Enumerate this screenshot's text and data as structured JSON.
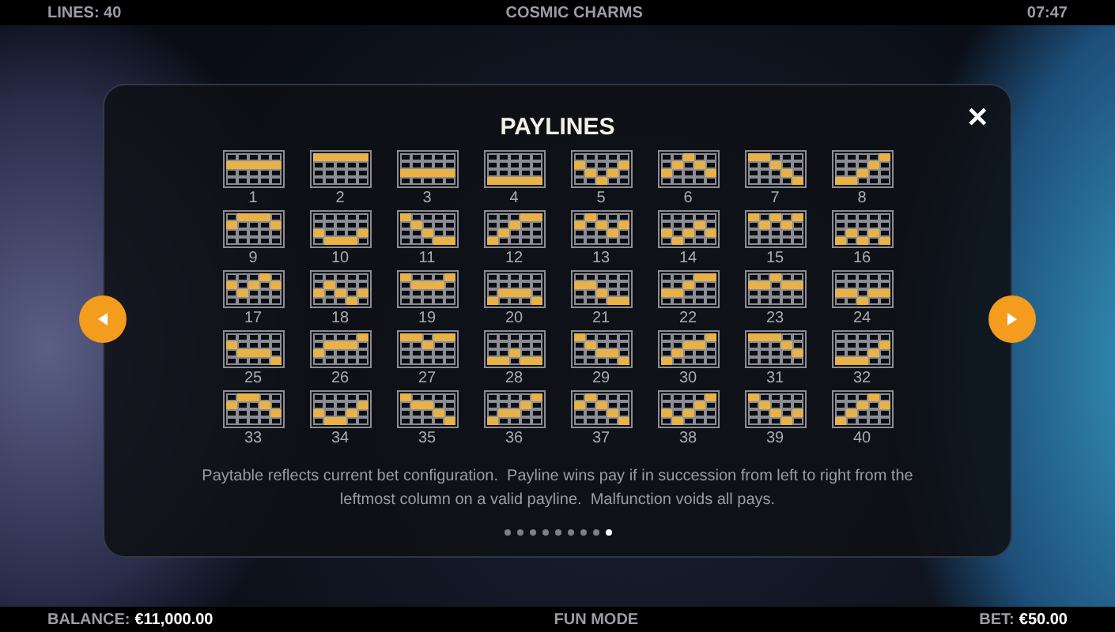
{
  "top_bar": {
    "lines": "LINES: 40",
    "title": "COSMIC CHARMS",
    "time": "07:47"
  },
  "dialog": {
    "title": "PAYLINES",
    "close": "✕",
    "paylines": [
      {
        "number": "1",
        "lit": [
          [
            false,
            false,
            false,
            false,
            false
          ],
          [
            true,
            true,
            true,
            true,
            true
          ],
          [
            false,
            false,
            false,
            false,
            false
          ],
          [
            false,
            false,
            false,
            false,
            false
          ]
        ]
      },
      {
        "number": "2",
        "lit": [
          [
            true,
            true,
            true,
            true,
            true
          ],
          [
            false,
            false,
            false,
            false,
            false
          ],
          [
            false,
            false,
            false,
            false,
            false
          ],
          [
            false,
            false,
            false,
            false,
            false
          ]
        ]
      },
      {
        "number": "3",
        "lit": [
          [
            false,
            false,
            false,
            false,
            false
          ],
          [
            false,
            false,
            false,
            false,
            false
          ],
          [
            true,
            true,
            true,
            true,
            true
          ],
          [
            false,
            false,
            false,
            false,
            false
          ]
        ]
      },
      {
        "number": "4",
        "lit": [
          [
            false,
            false,
            false,
            false,
            false
          ],
          [
            false,
            false,
            false,
            false,
            false
          ],
          [
            false,
            false,
            false,
            false,
            false
          ],
          [
            true,
            true,
            true,
            true,
            true
          ]
        ]
      },
      {
        "number": "5",
        "lit": [
          [
            false,
            false,
            false,
            false,
            false
          ],
          [
            true,
            false,
            false,
            false,
            true
          ],
          [
            false,
            true,
            false,
            true,
            false
          ],
          [
            false,
            false,
            true,
            false,
            false
          ]
        ]
      },
      {
        "number": "6",
        "lit": [
          [
            false,
            false,
            true,
            false,
            false
          ],
          [
            false,
            true,
            false,
            true,
            false
          ],
          [
            true,
            false,
            false,
            false,
            true
          ],
          [
            false,
            false,
            false,
            false,
            false
          ]
        ]
      },
      {
        "number": "7",
        "lit": [
          [
            true,
            true,
            false,
            false,
            false
          ],
          [
            false,
            false,
            true,
            false,
            false
          ],
          [
            false,
            false,
            false,
            true,
            false
          ],
          [
            false,
            false,
            false,
            false,
            true
          ]
        ]
      },
      {
        "number": "8",
        "lit": [
          [
            false,
            false,
            false,
            false,
            true
          ],
          [
            false,
            false,
            false,
            true,
            false
          ],
          [
            false,
            false,
            true,
            false,
            false
          ],
          [
            true,
            true,
            false,
            false,
            false
          ]
        ]
      },
      {
        "number": "9",
        "lit": [
          [
            false,
            true,
            true,
            true,
            false
          ],
          [
            true,
            false,
            false,
            false,
            true
          ],
          [
            false,
            false,
            false,
            false,
            false
          ],
          [
            false,
            false,
            false,
            false,
            false
          ]
        ]
      },
      {
        "number": "10",
        "lit": [
          [
            false,
            false,
            false,
            false,
            false
          ],
          [
            false,
            false,
            false,
            false,
            false
          ],
          [
            true,
            false,
            false,
            false,
            true
          ],
          [
            false,
            true,
            true,
            true,
            false
          ]
        ]
      },
      {
        "number": "11",
        "lit": [
          [
            true,
            false,
            false,
            false,
            false
          ],
          [
            false,
            true,
            false,
            false,
            false
          ],
          [
            false,
            false,
            true,
            false,
            false
          ],
          [
            false,
            false,
            false,
            true,
            true
          ]
        ]
      },
      {
        "number": "12",
        "lit": [
          [
            false,
            false,
            false,
            true,
            true
          ],
          [
            false,
            false,
            true,
            false,
            false
          ],
          [
            false,
            true,
            false,
            false,
            false
          ],
          [
            true,
            false,
            false,
            false,
            false
          ]
        ]
      },
      {
        "number": "13",
        "lit": [
          [
            false,
            true,
            false,
            false,
            false
          ],
          [
            true,
            false,
            true,
            false,
            true
          ],
          [
            false,
            false,
            false,
            true,
            false
          ],
          [
            false,
            false,
            false,
            false,
            false
          ]
        ]
      },
      {
        "number": "14",
        "lit": [
          [
            false,
            false,
            false,
            false,
            false
          ],
          [
            false,
            false,
            false,
            true,
            false
          ],
          [
            true,
            false,
            true,
            false,
            true
          ],
          [
            false,
            true,
            false,
            false,
            false
          ]
        ]
      },
      {
        "number": "15",
        "lit": [
          [
            true,
            false,
            true,
            false,
            true
          ],
          [
            false,
            true,
            false,
            true,
            false
          ],
          [
            false,
            false,
            false,
            false,
            false
          ],
          [
            false,
            false,
            false,
            false,
            false
          ]
        ]
      },
      {
        "number": "16",
        "lit": [
          [
            false,
            false,
            false,
            false,
            false
          ],
          [
            false,
            false,
            false,
            false,
            false
          ],
          [
            false,
            true,
            false,
            true,
            false
          ],
          [
            true,
            false,
            true,
            false,
            true
          ]
        ]
      },
      {
        "number": "17",
        "lit": [
          [
            false,
            false,
            false,
            true,
            false
          ],
          [
            true,
            false,
            true,
            false,
            true
          ],
          [
            false,
            true,
            false,
            false,
            false
          ],
          [
            false,
            false,
            false,
            false,
            false
          ]
        ]
      },
      {
        "number": "18",
        "lit": [
          [
            false,
            false,
            false,
            false,
            false
          ],
          [
            false,
            true,
            false,
            false,
            false
          ],
          [
            true,
            false,
            true,
            false,
            true
          ],
          [
            false,
            false,
            false,
            true,
            false
          ]
        ]
      },
      {
        "number": "19",
        "lit": [
          [
            true,
            false,
            false,
            false,
            true
          ],
          [
            false,
            true,
            true,
            true,
            false
          ],
          [
            false,
            false,
            false,
            false,
            false
          ],
          [
            false,
            false,
            false,
            false,
            false
          ]
        ]
      },
      {
        "number": "20",
        "lit": [
          [
            false,
            false,
            false,
            false,
            false
          ],
          [
            false,
            false,
            false,
            false,
            false
          ],
          [
            false,
            true,
            true,
            true,
            false
          ],
          [
            true,
            false,
            false,
            false,
            true
          ]
        ]
      },
      {
        "number": "21",
        "lit": [
          [
            false,
            false,
            false,
            false,
            false
          ],
          [
            true,
            true,
            false,
            false,
            false
          ],
          [
            false,
            false,
            true,
            false,
            false
          ],
          [
            false,
            false,
            false,
            true,
            true
          ]
        ]
      },
      {
        "number": "22",
        "lit": [
          [
            false,
            false,
            false,
            true,
            true
          ],
          [
            false,
            false,
            true,
            false,
            false
          ],
          [
            true,
            true,
            false,
            false,
            false
          ],
          [
            false,
            false,
            false,
            false,
            false
          ]
        ]
      },
      {
        "number": "23",
        "lit": [
          [
            false,
            false,
            true,
            false,
            false
          ],
          [
            true,
            true,
            false,
            true,
            true
          ],
          [
            false,
            false,
            false,
            false,
            false
          ],
          [
            false,
            false,
            false,
            false,
            false
          ]
        ]
      },
      {
        "number": "24",
        "lit": [
          [
            false,
            false,
            false,
            false,
            false
          ],
          [
            false,
            false,
            false,
            false,
            false
          ],
          [
            true,
            true,
            false,
            true,
            true
          ],
          [
            false,
            false,
            true,
            false,
            false
          ]
        ]
      },
      {
        "number": "25",
        "lit": [
          [
            false,
            false,
            false,
            false,
            false
          ],
          [
            true,
            false,
            false,
            false,
            false
          ],
          [
            false,
            true,
            true,
            true,
            false
          ],
          [
            false,
            false,
            false,
            false,
            true
          ]
        ]
      },
      {
        "number": "26",
        "lit": [
          [
            false,
            false,
            false,
            false,
            true
          ],
          [
            false,
            true,
            true,
            true,
            false
          ],
          [
            true,
            false,
            false,
            false,
            false
          ],
          [
            false,
            false,
            false,
            false,
            false
          ]
        ]
      },
      {
        "number": "27",
        "lit": [
          [
            true,
            true,
            false,
            true,
            true
          ],
          [
            false,
            false,
            true,
            false,
            false
          ],
          [
            false,
            false,
            false,
            false,
            false
          ],
          [
            false,
            false,
            false,
            false,
            false
          ]
        ]
      },
      {
        "number": "28",
        "lit": [
          [
            false,
            false,
            false,
            false,
            false
          ],
          [
            false,
            false,
            false,
            false,
            false
          ],
          [
            false,
            false,
            true,
            false,
            false
          ],
          [
            true,
            true,
            false,
            true,
            true
          ]
        ]
      },
      {
        "number": "29",
        "lit": [
          [
            true,
            false,
            false,
            false,
            false
          ],
          [
            false,
            true,
            false,
            false,
            false
          ],
          [
            false,
            false,
            true,
            true,
            false
          ],
          [
            false,
            false,
            false,
            false,
            true
          ]
        ]
      },
      {
        "number": "30",
        "lit": [
          [
            false,
            false,
            false,
            false,
            true
          ],
          [
            false,
            false,
            true,
            true,
            false
          ],
          [
            false,
            true,
            false,
            false,
            false
          ],
          [
            true,
            false,
            false,
            false,
            false
          ]
        ]
      },
      {
        "number": "31",
        "lit": [
          [
            true,
            true,
            true,
            false,
            false
          ],
          [
            false,
            false,
            false,
            true,
            false
          ],
          [
            false,
            false,
            false,
            false,
            true
          ],
          [
            false,
            false,
            false,
            false,
            false
          ]
        ]
      },
      {
        "number": "32",
        "lit": [
          [
            false,
            false,
            false,
            false,
            false
          ],
          [
            false,
            false,
            false,
            false,
            true
          ],
          [
            false,
            false,
            false,
            true,
            false
          ],
          [
            true,
            true,
            true,
            false,
            false
          ]
        ]
      },
      {
        "number": "33",
        "lit": [
          [
            false,
            true,
            true,
            false,
            false
          ],
          [
            true,
            false,
            false,
            true,
            false
          ],
          [
            false,
            false,
            false,
            false,
            true
          ],
          [
            false,
            false,
            false,
            false,
            false
          ]
        ]
      },
      {
        "number": "34",
        "lit": [
          [
            false,
            false,
            false,
            false,
            false
          ],
          [
            false,
            false,
            false,
            false,
            true
          ],
          [
            true,
            false,
            false,
            true,
            false
          ],
          [
            false,
            true,
            true,
            false,
            false
          ]
        ]
      },
      {
        "number": "35",
        "lit": [
          [
            true,
            false,
            false,
            false,
            false
          ],
          [
            false,
            true,
            true,
            false,
            false
          ],
          [
            false,
            false,
            false,
            true,
            false
          ],
          [
            false,
            false,
            false,
            false,
            true
          ]
        ]
      },
      {
        "number": "36",
        "lit": [
          [
            false,
            false,
            false,
            false,
            true
          ],
          [
            false,
            false,
            false,
            true,
            false
          ],
          [
            false,
            true,
            true,
            false,
            false
          ],
          [
            true,
            false,
            false,
            false,
            false
          ]
        ]
      },
      {
        "number": "37",
        "lit": [
          [
            false,
            true,
            false,
            false,
            false
          ],
          [
            true,
            false,
            true,
            false,
            false
          ],
          [
            false,
            false,
            false,
            true,
            false
          ],
          [
            false,
            false,
            false,
            false,
            true
          ]
        ]
      },
      {
        "number": "38",
        "lit": [
          [
            false,
            false,
            false,
            false,
            true
          ],
          [
            false,
            false,
            false,
            true,
            false
          ],
          [
            true,
            false,
            true,
            false,
            false
          ],
          [
            false,
            true,
            false,
            false,
            false
          ]
        ]
      },
      {
        "number": "39",
        "lit": [
          [
            true,
            false,
            false,
            false,
            false
          ],
          [
            false,
            true,
            false,
            false,
            false
          ],
          [
            false,
            false,
            true,
            false,
            true
          ],
          [
            false,
            false,
            false,
            true,
            false
          ]
        ]
      },
      {
        "number": "40",
        "lit": [
          [
            false,
            false,
            false,
            true,
            false
          ],
          [
            false,
            false,
            true,
            false,
            true
          ],
          [
            false,
            true,
            false,
            false,
            false
          ],
          [
            true,
            false,
            false,
            false,
            false
          ]
        ]
      }
    ],
    "note": "Paytable reflects current bet configuration.  Payline wins pay if in succession from left to right from the leftmost column on a valid payline.  Malfunction voids all pays.",
    "pages": [
      {
        "selected": false
      },
      {
        "selected": false
      },
      {
        "selected": false
      },
      {
        "selected": false
      },
      {
        "selected": false
      },
      {
        "selected": false
      },
      {
        "selected": false
      },
      {
        "selected": false
      },
      {
        "selected": true
      }
    ]
  },
  "bottom_bar": {
    "balance_label": "BALANCE:",
    "balance": "€11,000.00",
    "mode": "FUN MODE",
    "bet_label": "BET:",
    "bet": "€50.00"
  }
}
